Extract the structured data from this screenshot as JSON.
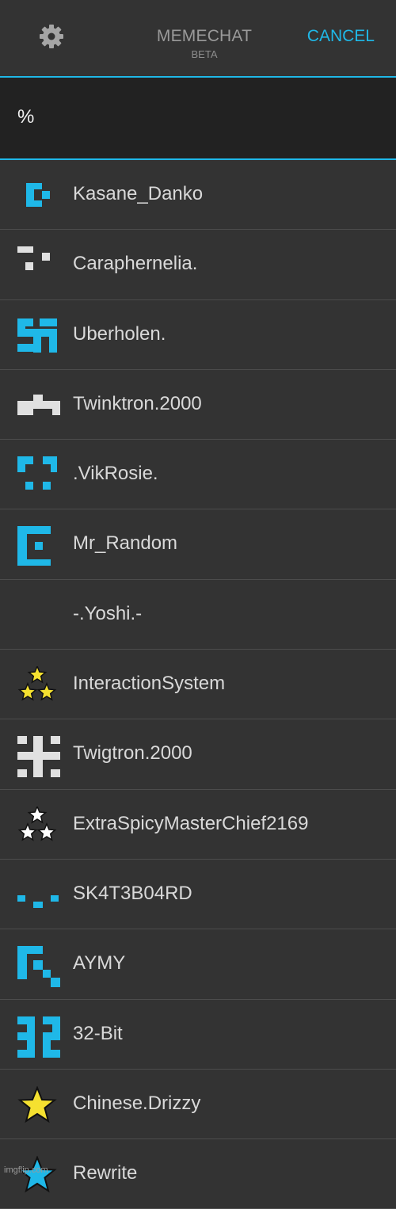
{
  "header": {
    "title": "MEMECHAT",
    "subtitle": "BETA",
    "cancel_label": "CANCEL"
  },
  "search": {
    "value": "%"
  },
  "users": [
    {
      "name": "Kasane_Danko",
      "icon": "blue-pixel-c-icon"
    },
    {
      "name": "Caraphernelia.",
      "icon": "gray-pixel-dots-icon"
    },
    {
      "name": "Uberholen.",
      "icon": "blue-pixel-cross-icon"
    },
    {
      "name": "Twinktron.2000",
      "icon": "gray-pixel-invader-icon"
    },
    {
      "name": ".VikRosie.",
      "icon": "blue-pixel-brackets-icon"
    },
    {
      "name": "Mr_Random",
      "icon": "blue-pixel-e-icon"
    },
    {
      "name": "-.Yoshi.-",
      "icon": ""
    },
    {
      "name": "InteractionSystem",
      "icon": "three-gold-stars-icon"
    },
    {
      "name": "Twigtron.2000",
      "icon": "gray-pixel-hash-icon"
    },
    {
      "name": "ExtraSpicyMasterChief2169",
      "icon": "three-white-stars-icon"
    },
    {
      "name": "SK4T3B04RD",
      "icon": "blue-pixel-dots-icon"
    },
    {
      "name": "AYMY",
      "icon": "blue-pixel-k-icon"
    },
    {
      "name": "32-Bit",
      "icon": "blue-pixel-32-icon"
    },
    {
      "name": "Chinese.Drizzy",
      "icon": "yellow-star-icon"
    },
    {
      "name": "Rewrite",
      "icon": "blue-star-icon"
    }
  ],
  "watermark": "imgflip.com",
  "colors": {
    "accent": "#1fb8e8",
    "background": "#333333",
    "search_background": "#222222",
    "text": "#d9d9d9",
    "pixel_gray": "#e0e0e0",
    "star_gold": "#f5e130"
  }
}
